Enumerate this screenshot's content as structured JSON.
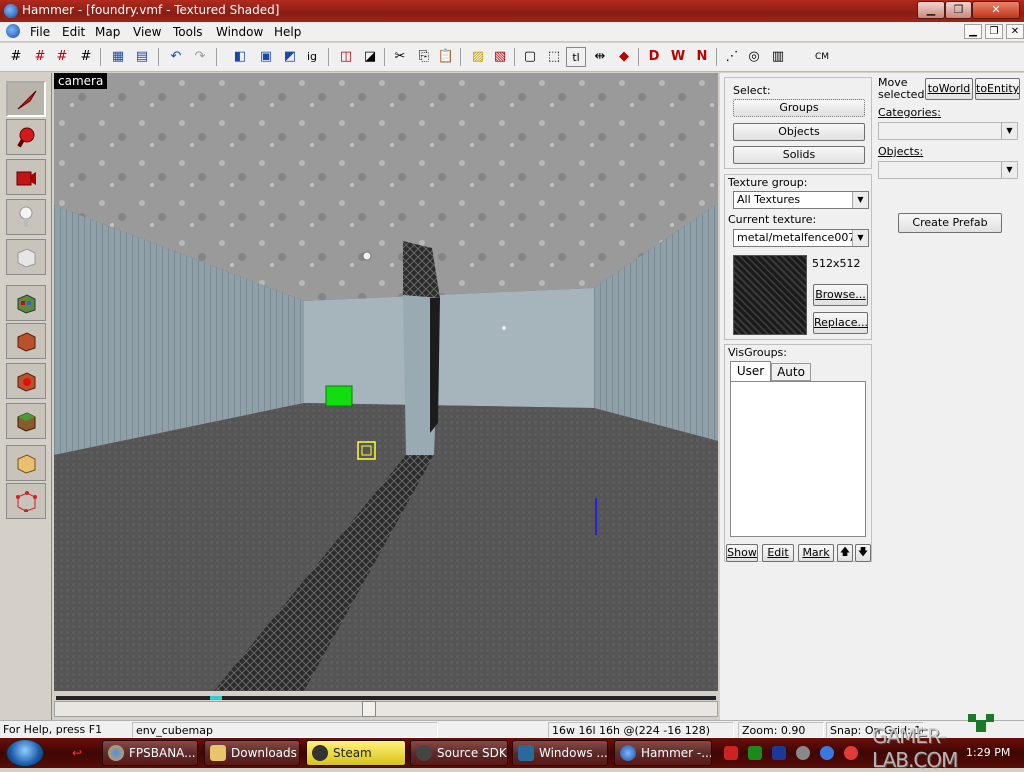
{
  "window": {
    "title": "Hammer - [foundry.vmf - Textured Shaded]",
    "minimize": "▁",
    "maximize": "❐",
    "close": "✕"
  },
  "menubar": {
    "items": [
      "File",
      "Edit",
      "Map",
      "View",
      "Tools",
      "Window",
      "Help"
    ],
    "mdi_minimize": "▁",
    "mdi_restore": "❐",
    "mdi_close": "✕"
  },
  "toolbar": {
    "cm_label": "CM",
    "ig_label": "ig",
    "tl_label": "tl"
  },
  "viewport": {
    "label": "camera"
  },
  "right_panel": {
    "select_label": "Select:",
    "groups_button": "Groups",
    "objects_button": "Objects",
    "solids_button": "Solids",
    "move_selected_label": "Move\nselected:",
    "move_label_line1": "Move",
    "move_label_line2": "selected:",
    "to_world_button": "toWorld",
    "to_entity_button": "toEntity",
    "categories_label": "Categories:",
    "objects_label": "Objects:",
    "create_prefab_button": "Create Prefab",
    "texture_group_label": "Texture group:",
    "texture_group_value": "All Textures",
    "current_texture_label": "Current texture:",
    "current_texture_value": "metal/metalfence007a",
    "texture_size": "512x512",
    "browse_button": "Browse...",
    "replace_button": "Replace...",
    "visgroups_label": "VisGroups:",
    "tab_user": "User",
    "tab_auto": "Auto",
    "show_button": "Show",
    "edit_button": "Edit",
    "mark_button": "Mark",
    "up_arrow": "🡅",
    "down_arrow": "🡇"
  },
  "statusbar": {
    "help": "For Help, press F1",
    "selection": "env_cubemap",
    "dimensions": "16w 16l 16h @(224 -16 128)",
    "zoom": "Zoom: 0.90",
    "snap": "Snap: On Grid: 16"
  },
  "taskbar": {
    "tasks": [
      "FPSBANA...",
      "Downloads",
      "Steam",
      "Source SDK",
      "Windows ...",
      "Hammer -..."
    ],
    "clock": "1:29 PM"
  },
  "watermark": {
    "text": "GAMER-LAB.COM"
  }
}
